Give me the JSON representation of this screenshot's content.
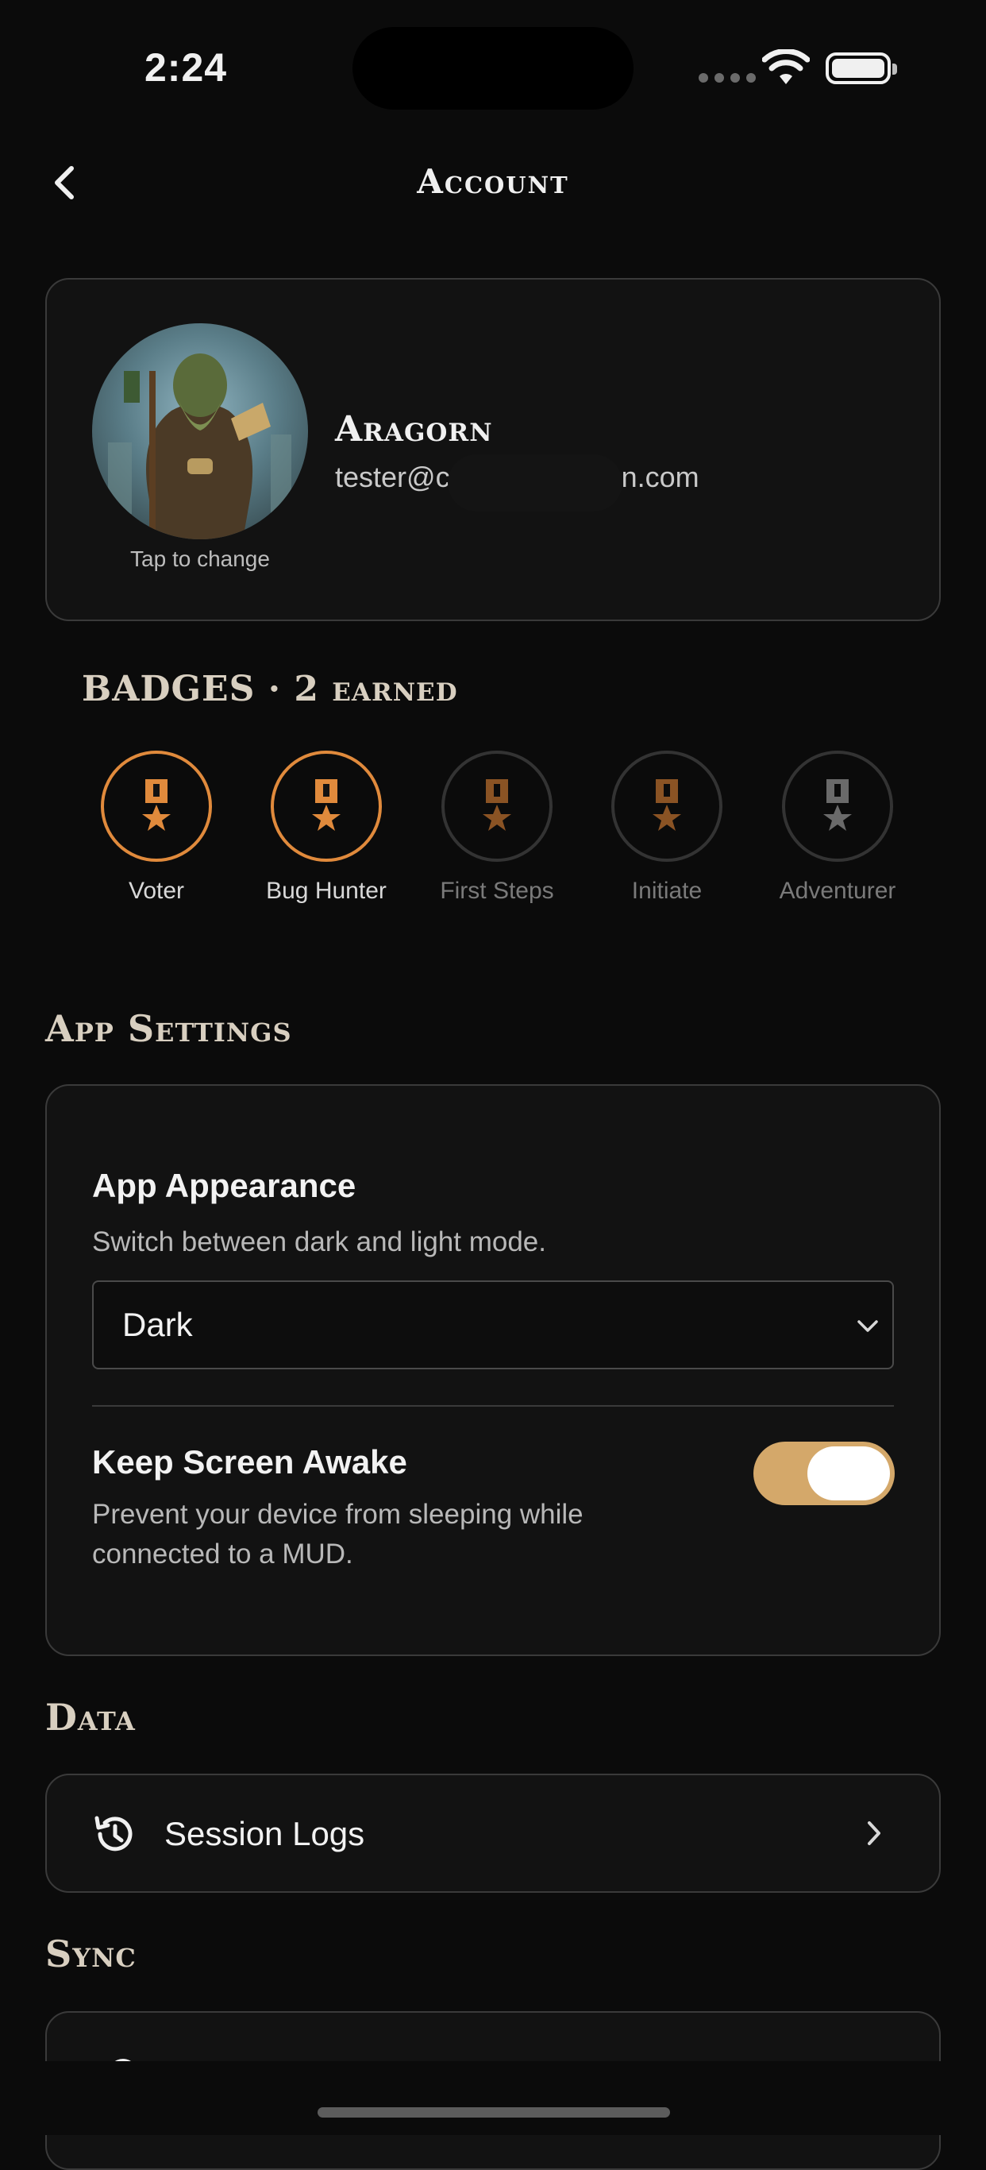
{
  "status_bar": {
    "time": "2:24"
  },
  "header": {
    "title": "Account"
  },
  "profile": {
    "name": "Aragorn",
    "email": "tester@c      n.com",
    "tap_hint": "Tap to change"
  },
  "badges": {
    "heading_main": "BADGES · 2",
    "heading_small": "earned",
    "items": [
      {
        "label": "Voter",
        "earned": true
      },
      {
        "label": "Bug Hunter",
        "earned": true
      },
      {
        "label": "First Steps",
        "earned": false
      },
      {
        "label": "Initiate",
        "earned": false
      },
      {
        "label": "Adventurer",
        "earned": false
      }
    ]
  },
  "app_settings": {
    "heading": "App Settings",
    "appearance": {
      "title": "App Appearance",
      "description": "Switch between dark and light mode.",
      "value": "Dark"
    },
    "keep_awake": {
      "title": "Keep Screen Awake",
      "description_line1": "Prevent your device from sleeping while",
      "description_line2": "connected to a MUD.",
      "enabled": true
    }
  },
  "data_section": {
    "heading": "Data",
    "session_logs_label": "Session Logs"
  },
  "sync_section": {
    "heading": "Sync"
  },
  "colors": {
    "accent": "#d4a86a",
    "badge_earned": "#e08a3c",
    "background": "#0b0b0b",
    "card": "#121212"
  }
}
